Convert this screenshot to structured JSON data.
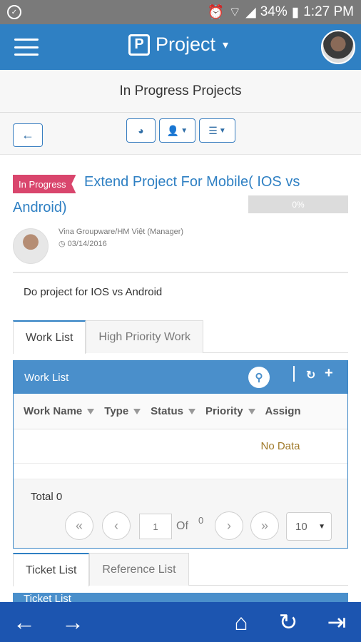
{
  "status_bar": {
    "battery": "34%",
    "time": "1:27 PM"
  },
  "app_bar": {
    "title": "Project",
    "logo_letter": "P"
  },
  "page": {
    "heading": "In Progress Projects"
  },
  "project": {
    "status_badge": "In Progress",
    "title": "Extend Project For Mobile( IOS vs Android)",
    "progress": "0%",
    "progress_value": 0,
    "member": "Vina Groupware/HM Việt (Manager)",
    "date": "03/14/2016",
    "description": "Do project for IOS vs Android"
  },
  "work_tabs": [
    "Work List",
    "High Priority Work"
  ],
  "work_panel": {
    "title": "Work List",
    "columns": [
      "Work Name",
      "Type",
      "Status",
      "Priority",
      "Assign"
    ],
    "empty_text": "No Data",
    "total": "Total 0",
    "page_input": "1",
    "of_label": "Of",
    "page_count": "0",
    "page_size": "10"
  },
  "ticket_tabs": [
    "Ticket List",
    "Reference List"
  ],
  "ticket_panel": {
    "title": "Ticket List"
  },
  "icons": {
    "back": "arrow-left-icon",
    "forward": "arrow-right-icon",
    "home": "home-icon",
    "refresh": "refresh-icon",
    "exit": "logout-icon"
  },
  "colors": {
    "appbar": "#2f80c3",
    "badge": "#d9466d",
    "bottombar": "#1c55b0",
    "panel_header": "#4a8fcb"
  }
}
